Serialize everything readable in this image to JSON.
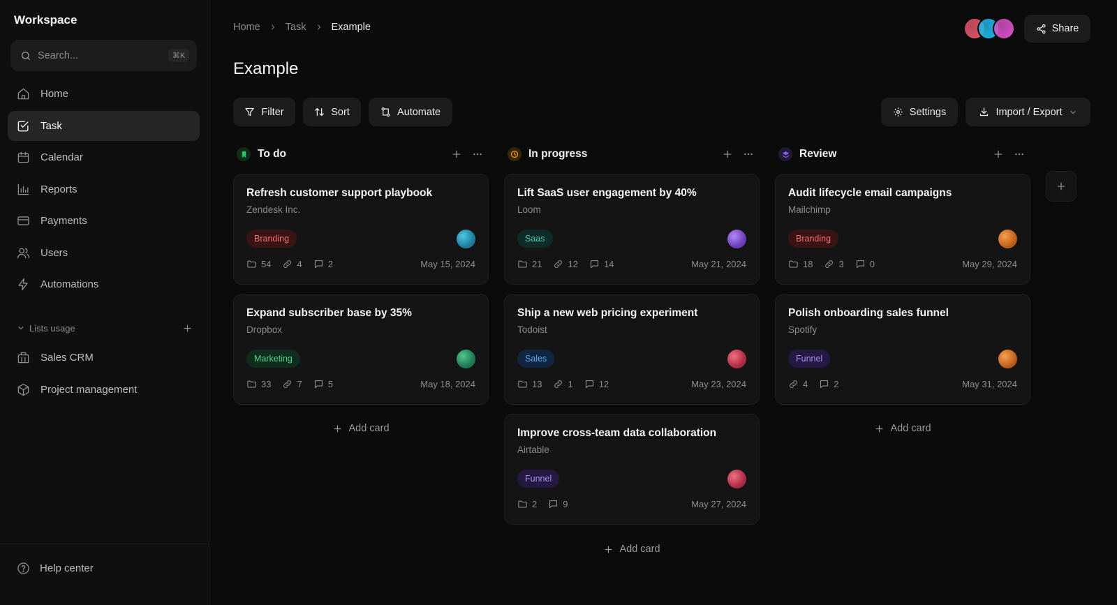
{
  "sidebar": {
    "workspace": "Workspace",
    "search": {
      "placeholder": "Search...",
      "shortcut": "⌘K"
    },
    "nav": [
      {
        "label": "Home",
        "icon": "home-icon"
      },
      {
        "label": "Task",
        "icon": "task-checkbox-icon",
        "active": true
      },
      {
        "label": "Calendar",
        "icon": "calendar-icon"
      },
      {
        "label": "Reports",
        "icon": "bar-chart-icon"
      },
      {
        "label": "Payments",
        "icon": "credit-card-icon"
      },
      {
        "label": "Users",
        "icon": "users-icon"
      },
      {
        "label": "Automations",
        "icon": "lightning-icon"
      }
    ],
    "lists_label": "Lists usage",
    "lists": [
      {
        "label": "Sales CRM",
        "icon": "building-icon"
      },
      {
        "label": "Project management",
        "icon": "box-icon"
      }
    ],
    "help": "Help center"
  },
  "header": {
    "breadcrumb": [
      "Home",
      "Task",
      "Example"
    ],
    "share": "Share",
    "avatar_colors": [
      "#e2566a",
      "#1fb6e8",
      "#d651c7"
    ]
  },
  "page": {
    "title": "Example"
  },
  "toolbar": {
    "filter": "Filter",
    "sort": "Sort",
    "automate": "Automate",
    "settings": "Settings",
    "import_export": "Import / Export"
  },
  "board": {
    "add_card": "Add card",
    "columns": [
      {
        "title": "To do",
        "status_color": "#22c55e",
        "cards": [
          {
            "title": "Refresh customer support playbook",
            "company": "Zendesk Inc.",
            "tag": "Branding",
            "folders": "54",
            "links": "4",
            "comments": "2",
            "date": "May 15, 2024"
          },
          {
            "title": "Expand subscriber base by 35%",
            "company": "Dropbox",
            "tag": "Marketing",
            "folders": "33",
            "links": "7",
            "comments": "5",
            "date": "May 18, 2024"
          }
        ]
      },
      {
        "title": "In progress",
        "status_color": "#f59e0b",
        "cards": [
          {
            "title": "Lift SaaS user engagement by 40%",
            "company": "Loom",
            "tag": "Saas",
            "folders": "21",
            "links": "12",
            "comments": "14",
            "date": "May 21, 2024"
          },
          {
            "title": "Ship a new web pricing experiment",
            "company": "Todoist",
            "tag": "Sales",
            "folders": "13",
            "links": "1",
            "comments": "12",
            "date": "May 23, 2024"
          },
          {
            "title": "Improve cross-team data collaboration",
            "company": "Airtable",
            "tag": "Funnel",
            "folders": "2",
            "comments": "9",
            "date": "May 27, 2024"
          }
        ]
      },
      {
        "title": "Review",
        "status_color": "#8b5cf6",
        "cards": [
          {
            "title": "Audit lifecycle email campaigns",
            "company": "Mailchimp",
            "tag": "Branding",
            "folders": "18",
            "links": "3",
            "comments": "0",
            "date": "May 29, 2024"
          },
          {
            "title": "Polish onboarding sales funnel",
            "company": "Spotify",
            "tag": "Funnel",
            "links": "4",
            "comments": "2",
            "date": "May 31, 2024"
          }
        ]
      }
    ]
  }
}
